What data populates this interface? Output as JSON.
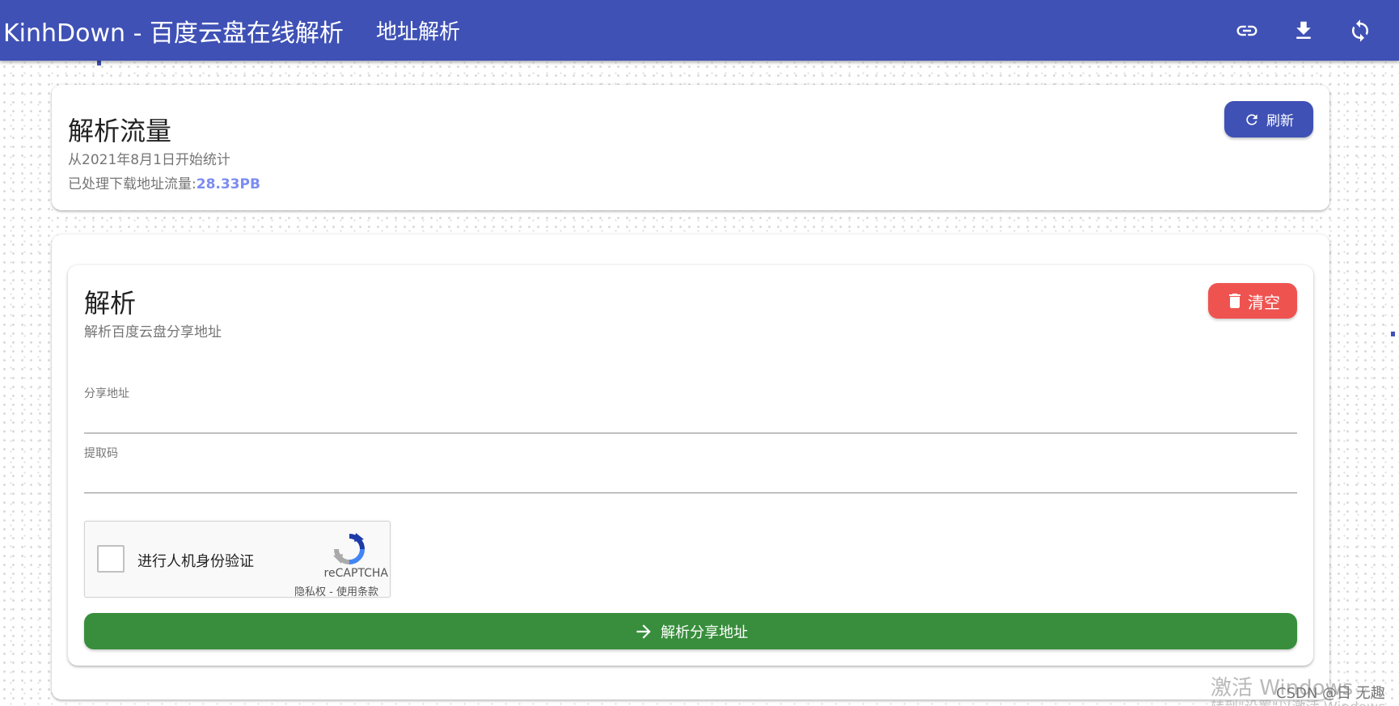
{
  "appbar": {
    "title": "KinhDown - 百度云盘在线解析",
    "nav_link": "地址解析",
    "actions": [
      {
        "icon": "link-icon"
      },
      {
        "icon": "download-icon"
      },
      {
        "icon": "sync-icon"
      }
    ]
  },
  "stats_card": {
    "title": "解析流量",
    "since": "从2021年8月1日开始统计",
    "processed_label": "已处理下载地址流量:",
    "processed_value": "28.33PB",
    "refresh_label": "刷新"
  },
  "parse_card": {
    "title": "解析",
    "subtitle": "解析百度云盘分享地址",
    "clear_label": "清空",
    "share_url": {
      "label": "分享地址",
      "value": ""
    },
    "extract_code": {
      "label": "提取码",
      "value": ""
    },
    "submit_label": "解析分享地址"
  },
  "recaptcha": {
    "label": "进行人机身份验证",
    "brand": "reCAPTCHA",
    "privacy": "隐私权",
    "separator": " - ",
    "terms": "使用条款"
  },
  "overlay": {
    "watermark": "激活 Windows",
    "watermark_sub": "转到\"设置\"以激活 Windows。",
    "credit": "CSDN @日 无趣"
  },
  "colors": {
    "primary": "#3f51b5",
    "danger": "#ef5350",
    "success": "#388e3c",
    "accent_text": "#7c8cf0"
  }
}
